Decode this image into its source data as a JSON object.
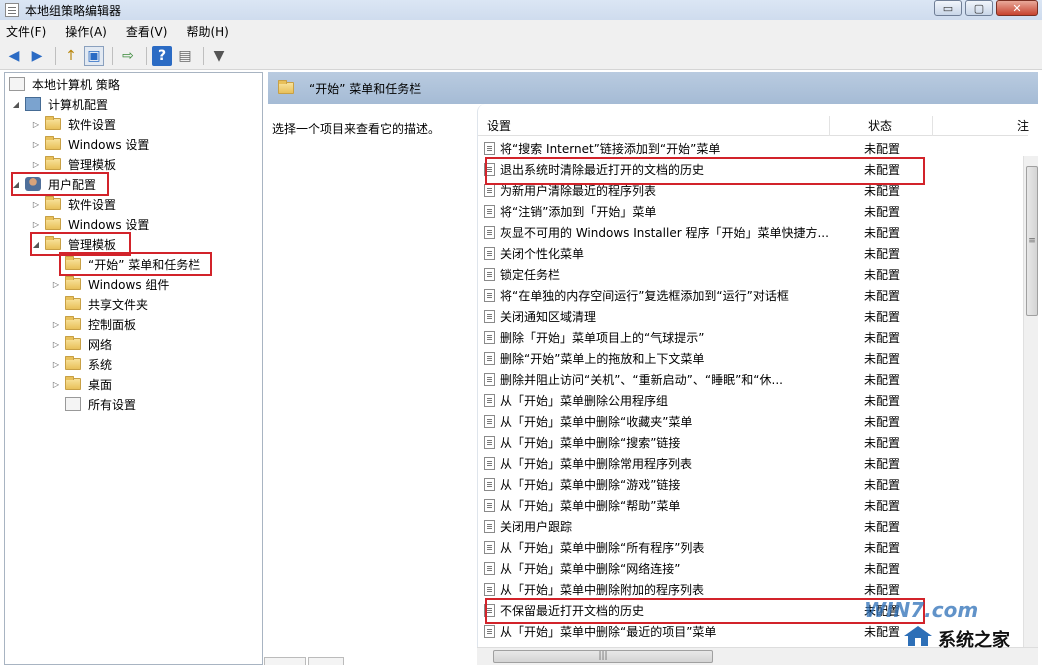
{
  "window": {
    "title": "本地组策略编辑器",
    "min": "▭",
    "max": "▢",
    "close": "✕"
  },
  "menu": [
    "文件(F)",
    "操作(A)",
    "查看(V)",
    "帮助(H)"
  ],
  "toolbar": {
    "back": "◀",
    "forward": "▶",
    "up": "↑",
    "show_hide": "▣",
    "export": "⇨",
    "help": "?",
    "props": "▤",
    "filter": "▼"
  },
  "tree": {
    "root": "本地计算机 策略",
    "computer_config": "计算机配置",
    "cc_software": "软件设置",
    "cc_windows": "Windows 设置",
    "cc_admin": "管理模板",
    "user_config": "用户配置",
    "uc_software": "软件设置",
    "uc_windows": "Windows 设置",
    "uc_admin": "管理模板",
    "start_menu": "“开始” 菜单和任务栏",
    "win_components": "Windows 组件",
    "shared_folders": "共享文件夹",
    "control_panel": "控制面板",
    "network": "网络",
    "system": "系统",
    "desktop": "桌面",
    "all_settings": "所有设置"
  },
  "header": {
    "title": "“开始” 菜单和任务栏"
  },
  "description": "选择一个项目来查看它的描述。",
  "columns": {
    "setting": "设置",
    "state": "状态",
    "extra": "注"
  },
  "settings": [
    {
      "name": "将“搜索 Internet”链接添加到“开始”菜单",
      "state": "未配置"
    },
    {
      "name": "退出系统时清除最近打开的文档的历史",
      "state": "未配置"
    },
    {
      "name": "为新用户清除最近的程序列表",
      "state": "未配置"
    },
    {
      "name": "将“注销”添加到「开始」菜单",
      "state": "未配置"
    },
    {
      "name": "灰显不可用的 Windows Installer 程序「开始」菜单快捷方...",
      "state": "未配置"
    },
    {
      "name": "关闭个性化菜单",
      "state": "未配置"
    },
    {
      "name": "锁定任务栏",
      "state": "未配置"
    },
    {
      "name": "将“在单独的内存空间运行”复选框添加到“运行”对话框",
      "state": "未配置"
    },
    {
      "name": "关闭通知区域清理",
      "state": "未配置"
    },
    {
      "name": "删除「开始」菜单项目上的“气球提示”",
      "state": "未配置"
    },
    {
      "name": "删除“开始”菜单上的拖放和上下文菜单",
      "state": "未配置"
    },
    {
      "name": "删除并阻止访问“关机”、“重新启动”、“睡眠”和“休...",
      "state": "未配置"
    },
    {
      "name": "从「开始」菜单删除公用程序组",
      "state": "未配置"
    },
    {
      "name": "从「开始」菜单中删除“收藏夹”菜单",
      "state": "未配置"
    },
    {
      "name": "从「开始」菜单中删除“搜索”链接",
      "state": "未配置"
    },
    {
      "name": "从「开始」菜单中删除常用程序列表",
      "state": "未配置"
    },
    {
      "name": "从「开始」菜单中删除“游戏”链接",
      "state": "未配置"
    },
    {
      "name": "从「开始」菜单中删除“帮助”菜单",
      "state": "未配置"
    },
    {
      "name": "关闭用户跟踪",
      "state": "未配置"
    },
    {
      "name": "从「开始」菜单中删除“所有程序”列表",
      "state": "未配置"
    },
    {
      "name": "从「开始」菜单中删除“网络连接”",
      "state": "未配置"
    },
    {
      "name": "从「开始」菜单中删除附加的程序列表",
      "state": "未配置"
    },
    {
      "name": "不保留最近打开文档的历史",
      "state": "未配置"
    },
    {
      "name": "从「开始」菜单中删除“最近的项目”菜单",
      "state": "未配置"
    }
  ],
  "watermark": {
    "brand": "WIN7.com",
    "site": "系统之家"
  },
  "colors": {
    "highlight_box": "#d2232a",
    "header_bg": "#b9cbe0",
    "folder": "#e8c05a"
  }
}
